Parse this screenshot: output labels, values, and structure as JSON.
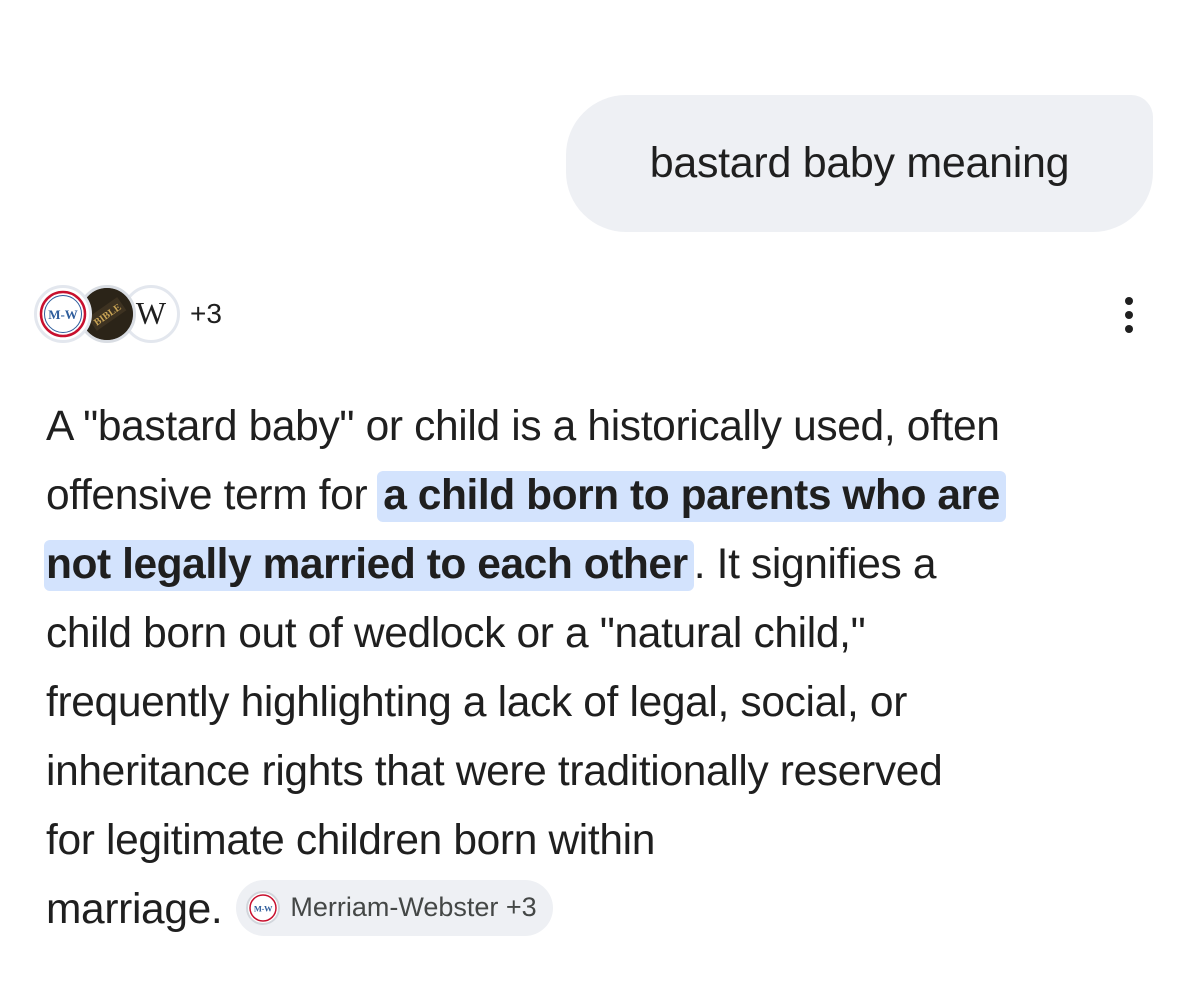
{
  "query": {
    "text": "bastard baby meaning"
  },
  "sources": {
    "icons": [
      "merriam-webster-logo",
      "bible-logo",
      "wikipedia-logo"
    ],
    "mw_logo_text": "M-W",
    "bible_logo_text": "BIBLE",
    "wiki_logo_text": "W",
    "more_count": "+3"
  },
  "answer": {
    "line1": "A \"bastard baby\" or child is a historically used, often",
    "line2_pre": "offensive term for",
    "highlight_part1": "a child born to parents who are",
    "highlight_part2": "not legally married to each other",
    "line3_post": ". It signifies a",
    "line4": "child born out of wedlock or a \"natural child,\"",
    "line5": "frequently highlighting a lack of legal, social, or",
    "line6": "inheritance rights that were traditionally reserved",
    "line7": "for legitimate children born within",
    "line8": "marriage."
  },
  "citation_chip": {
    "icon": "merriam-webster-logo",
    "icon_text": "M-W",
    "label": "Merriam-Webster +3"
  },
  "colors": {
    "bubble_bg": "#eef0f4",
    "highlight_bg": "#d3e3fd",
    "text": "#1f1f1f",
    "chip_text": "#444746",
    "mw_red": "#c8102e",
    "mw_blue": "#2e5d9c"
  }
}
